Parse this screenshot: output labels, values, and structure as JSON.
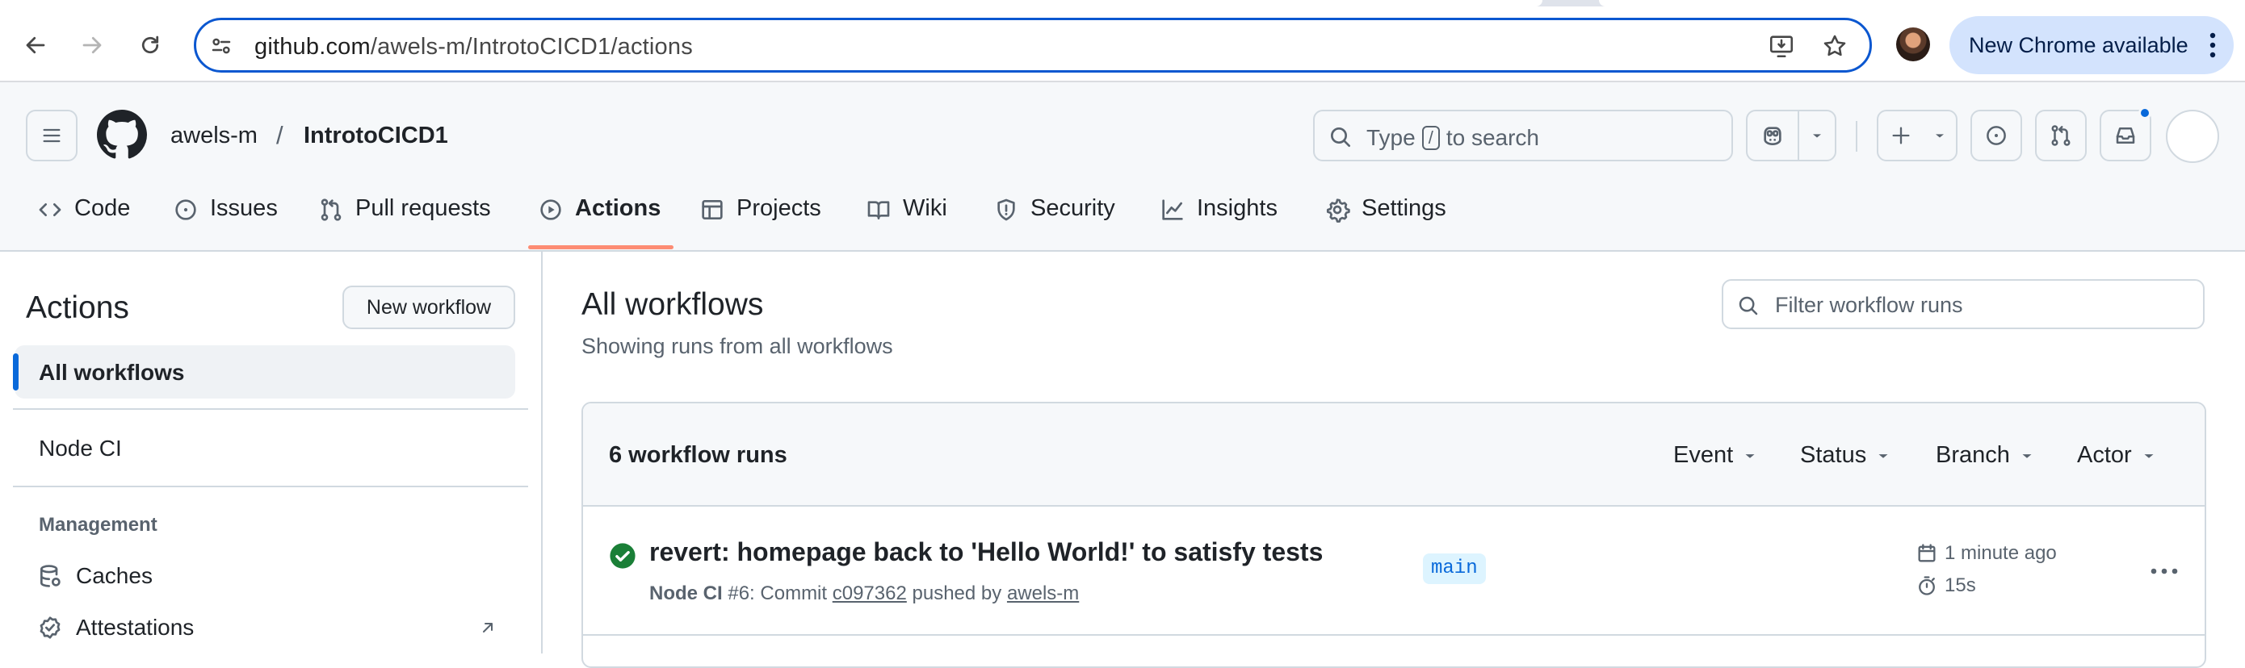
{
  "browser": {
    "url_host": "github.com",
    "url_path": "/awels-m/IntrotoCICD1/actions",
    "update_button": "New Chrome available"
  },
  "header": {
    "owner": "awels-m",
    "separator": "/",
    "repo": "IntrotoCICD1",
    "search": {
      "prefix": "Type",
      "key": "/",
      "suffix": "to search"
    }
  },
  "repo_nav": {
    "tabs": [
      {
        "label": "Code",
        "icon": "code-icon"
      },
      {
        "label": "Issues",
        "icon": "issue-icon"
      },
      {
        "label": "Pull requests",
        "icon": "pull-request-icon"
      },
      {
        "label": "Actions",
        "icon": "play-icon",
        "active": true
      },
      {
        "label": "Projects",
        "icon": "table-icon"
      },
      {
        "label": "Wiki",
        "icon": "book-icon"
      },
      {
        "label": "Security",
        "icon": "shield-icon"
      },
      {
        "label": "Insights",
        "icon": "graph-icon"
      },
      {
        "label": "Settings",
        "icon": "gear-icon"
      }
    ]
  },
  "sidebar": {
    "title": "Actions",
    "new_workflow": "New workflow",
    "active_item": "All workflows",
    "workflows": [
      "Node CI"
    ],
    "management_heading": "Management",
    "management": [
      {
        "label": "Caches",
        "icon": "database-icon"
      },
      {
        "label": "Attestations",
        "icon": "verified-icon"
      }
    ]
  },
  "main": {
    "title": "All workflows",
    "subtitle": "Showing runs from all workflows",
    "filter_placeholder": "Filter workflow runs",
    "runs_count": "6 workflow runs",
    "filters": [
      "Event",
      "Status",
      "Branch",
      "Actor"
    ],
    "runs": [
      {
        "status": "success",
        "title": "revert: homepage back to 'Hello World!' to satisfy tests",
        "workflow": "Node CI",
        "run_number": "#6",
        "commit_label": "Commit",
        "commit": "c097362",
        "pushed_by_label": "pushed by",
        "author": "awels-m",
        "branch": "main",
        "time": "1 minute ago",
        "duration": "15s"
      }
    ]
  },
  "colors": {
    "accent": "#0969da",
    "active_tab_underline": "#fd8c73",
    "success": "#1a7f37",
    "omnibox_focus": "#0b57d0"
  }
}
